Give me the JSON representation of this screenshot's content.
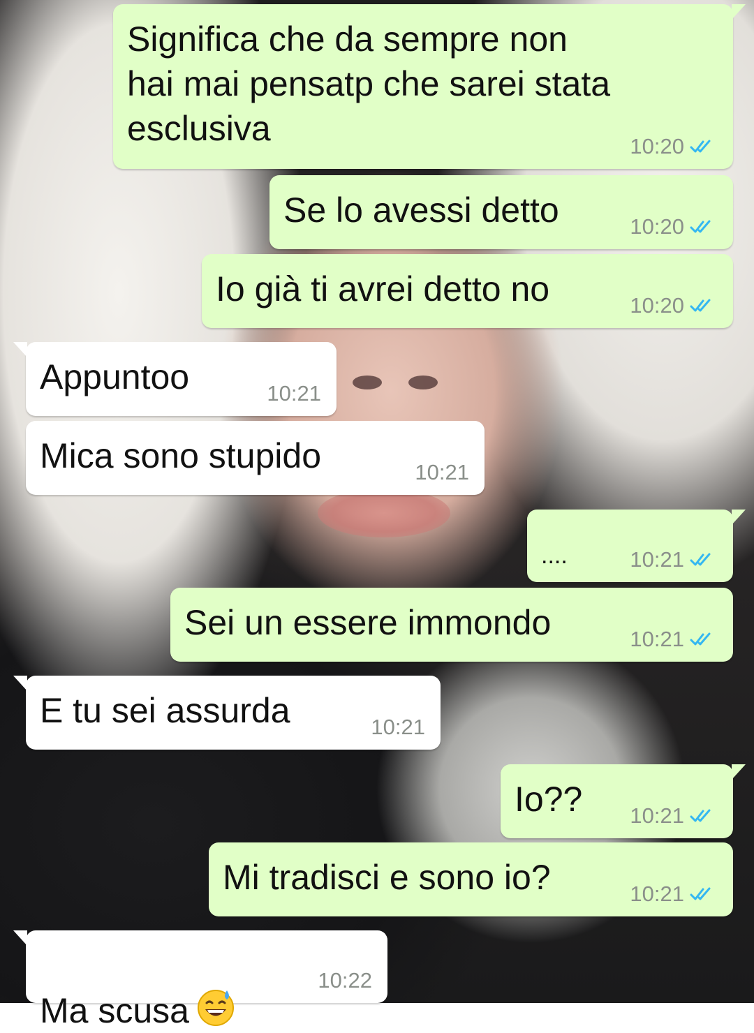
{
  "chat": {
    "messages": [
      {
        "dir": "out",
        "text": "Significa che da sempre non\nhai mai pensatp che sarei stata\nesclusiva",
        "time": "10:20",
        "status": "read"
      },
      {
        "dir": "out",
        "text": "Se lo avessi detto",
        "time": "10:20",
        "status": "read"
      },
      {
        "dir": "out",
        "text": "Io già ti avrei detto no",
        "time": "10:20",
        "status": "read"
      },
      {
        "dir": "in",
        "text": "Appuntoo",
        "time": "10:21"
      },
      {
        "dir": "in",
        "text": "Mica sono stupido",
        "time": "10:21"
      },
      {
        "dir": "out",
        "text": "....",
        "time": "10:21",
        "status": "read"
      },
      {
        "dir": "out",
        "text": "Sei un essere immondo",
        "time": "10:21",
        "status": "read"
      },
      {
        "dir": "in",
        "text": "E tu sei assurda",
        "time": "10:21"
      },
      {
        "dir": "out",
        "text": "Io??",
        "time": "10:21",
        "status": "read"
      },
      {
        "dir": "out",
        "text": "Mi tradisci e sono io?",
        "time": "10:21",
        "status": "read"
      },
      {
        "dir": "in",
        "text": "Ma scusa",
        "time": "10:22",
        "emoji": "grinning-face-with-sweat-icon"
      }
    ]
  },
  "colors": {
    "outgoing_bubble": "#e1ffc7",
    "incoming_bubble": "#ffffff",
    "read_ticks": "#34b7f1",
    "timestamp": "#8a8f8a"
  },
  "icons": {
    "read_status": "double-check-icon"
  }
}
